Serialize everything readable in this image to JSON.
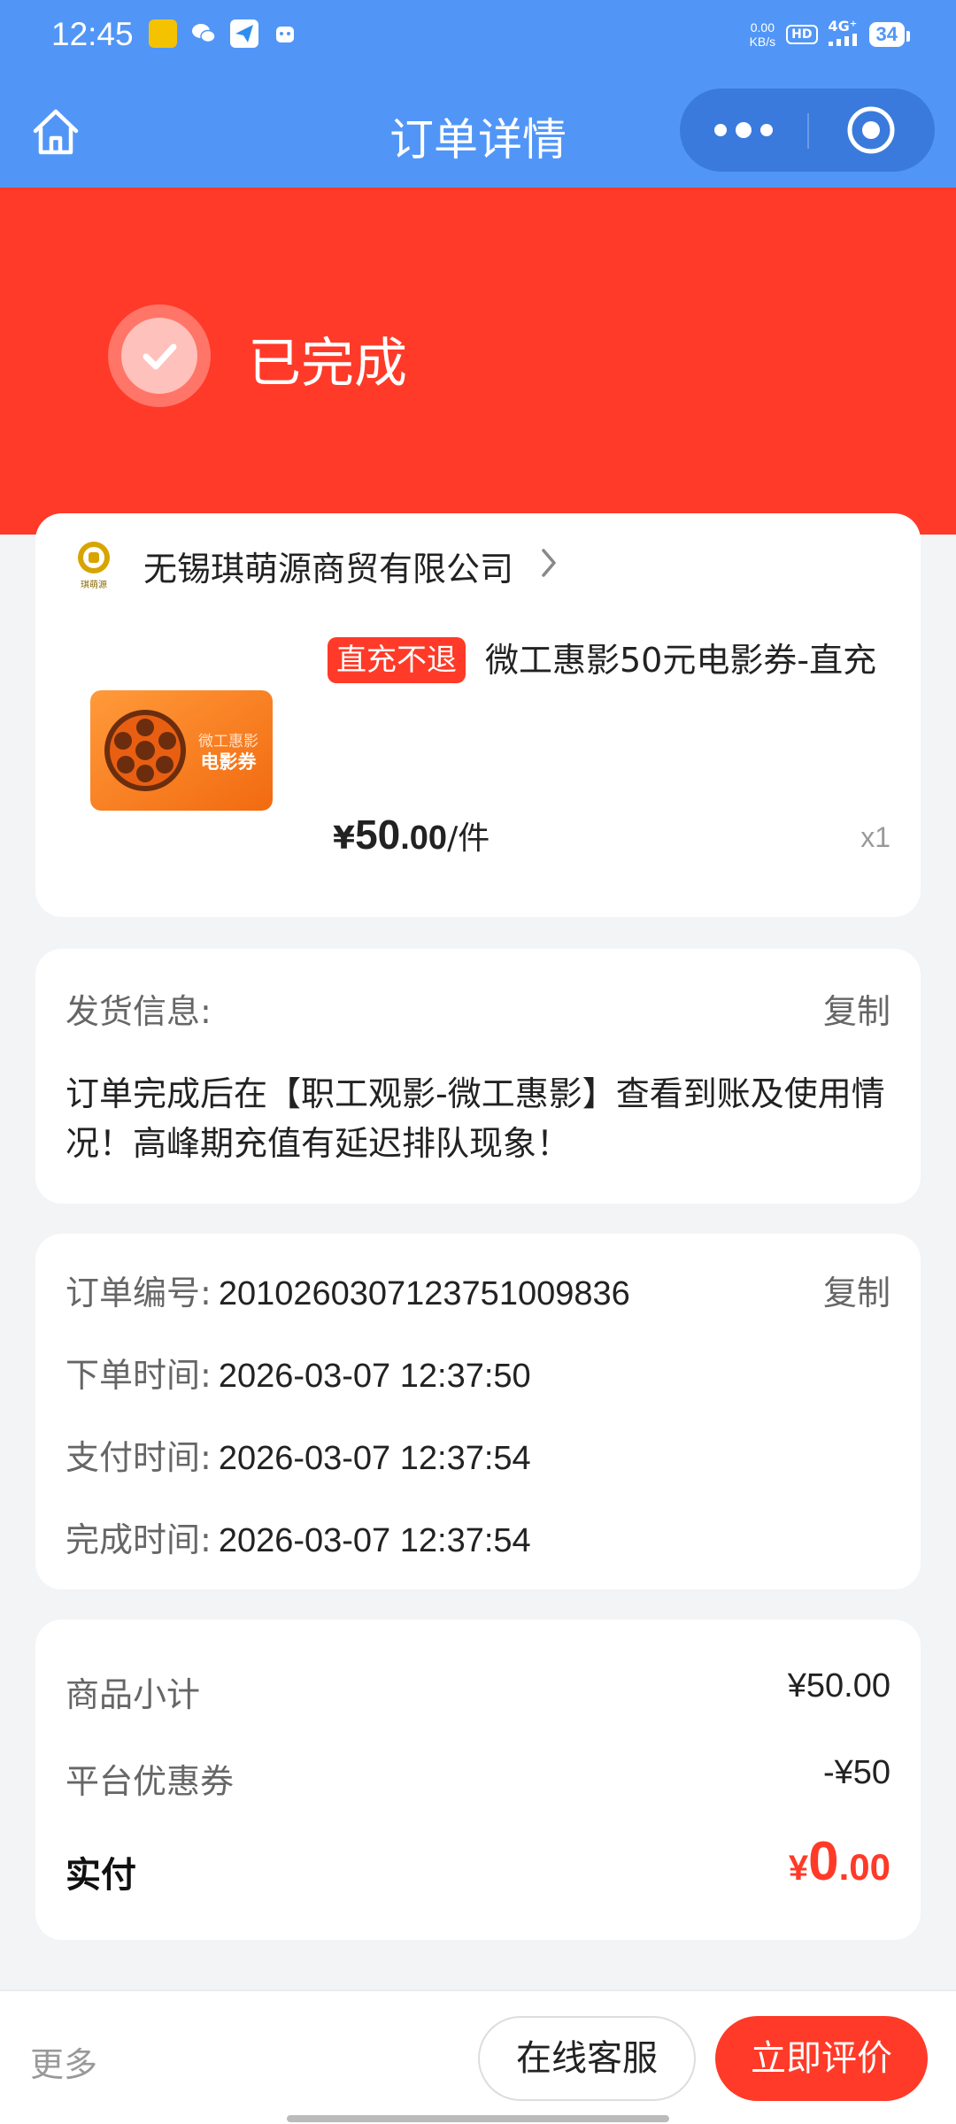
{
  "status_bar": {
    "time": "12:45",
    "net_speed_value": "0.00",
    "net_speed_unit": "KB/s",
    "hd": "HD",
    "network": "4G⁺",
    "battery": "34"
  },
  "nav": {
    "title": "订单详情",
    "background_color": "#5196f7"
  },
  "status": {
    "label": "已完成",
    "banner_color": "#ff3a28"
  },
  "order_item": {
    "shop_name": "无锡琪萌源商贸有限公司",
    "shop_logo_text": "琪萌源",
    "tag": "直充不退",
    "product_name": "微工惠影50元电影券-直充",
    "thumb_line1": "微工惠影",
    "thumb_line2": "电影券",
    "price_currency": "¥",
    "price_int": "50",
    "price_dec": ".00",
    "price_unit": "/件",
    "quantity": "x1"
  },
  "shipping": {
    "label": "发货信息:",
    "copy_label": "复制",
    "text": "订单完成后在【职工观影-微工惠影】查看到账及使用情况！高峰期充值有延迟排队现象！"
  },
  "order_info": {
    "copy_label": "复制",
    "rows": [
      {
        "label": "订单编号:",
        "value": "2010260307123751009836"
      },
      {
        "label": "下单时间:",
        "value": "2026-03-07 12:37:50"
      },
      {
        "label": "支付时间:",
        "value": "2026-03-07 12:37:54"
      },
      {
        "label": "完成时间:",
        "value": "2026-03-07 12:37:54"
      }
    ]
  },
  "summary": {
    "subtotal_label": "商品小计",
    "subtotal_value": "¥50.00",
    "coupon_label": "平台优惠券",
    "coupon_value": "-¥50",
    "paid_label": "实付",
    "paid_currency": "¥",
    "paid_int": "0",
    "paid_dec": ".00"
  },
  "bottom_bar": {
    "more_label": "更多",
    "service_label": "在线客服",
    "review_label": "立即评价",
    "accent_color": "#ff3a28"
  }
}
